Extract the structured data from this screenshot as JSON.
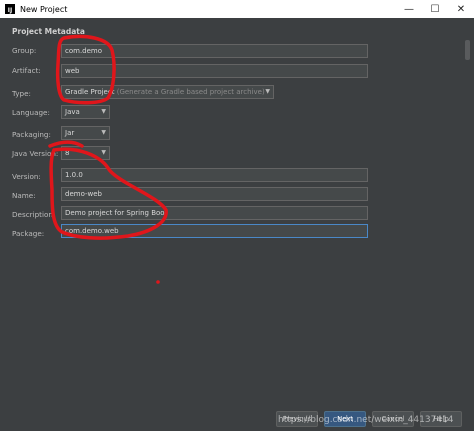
{
  "window": {
    "title": "New Project",
    "app_icon_text": "IJ",
    "minimize": "—",
    "maximize": "☐",
    "close": "✕"
  },
  "section_title": "Project Metadata",
  "form": {
    "group": {
      "label": "Group:",
      "value": "com.demo"
    },
    "artifact": {
      "label": "Artifact:",
      "value": "web"
    },
    "type": {
      "label": "Type:",
      "value": "Gradle Project",
      "hint": "Generate a Gradle based project archive)"
    },
    "language": {
      "label": "Language:",
      "value": "Java"
    },
    "packaging": {
      "label": "Packaging:",
      "value": "Jar"
    },
    "java_version": {
      "label": "Java Version:",
      "value": "8"
    },
    "version": {
      "label": "Version:",
      "value": "1.0.0"
    },
    "name": {
      "label": "Name:",
      "value": "demo-web"
    },
    "description": {
      "label": "Description:",
      "value": "Demo project for Spring Boot"
    },
    "package": {
      "label": "Package:",
      "value": "com.demo.web"
    }
  },
  "buttons": {
    "previous": "Previous",
    "next": "Next",
    "cancel": "Cancel",
    "help": "Help"
  },
  "watermark": "https://blog.csdn.net/weixin_44137414",
  "colors": {
    "background": "#3c3f41",
    "field_bg": "#45494a",
    "focus_border": "#4a88c7",
    "primary_button": "#365880",
    "annotation_red": "#e0161b"
  }
}
